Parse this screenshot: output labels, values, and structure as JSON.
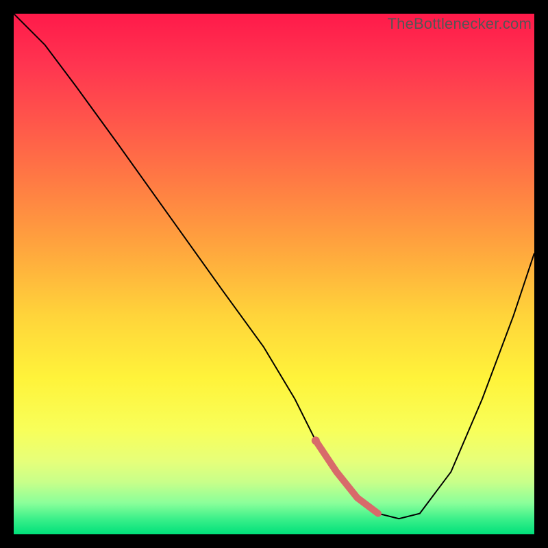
{
  "watermark": "TheBottlenecker.com",
  "chart_data": {
    "type": "line",
    "title": "",
    "xlabel": "",
    "ylabel": "",
    "xlim": [
      0,
      100
    ],
    "ylim": [
      0,
      100
    ],
    "series": [
      {
        "name": "curve",
        "x": [
          0,
          6,
          12,
          20,
          30,
          40,
          48,
          54,
          58,
          62,
          66,
          70,
          74,
          78,
          84,
          90,
          96,
          100
        ],
        "values": [
          100,
          94,
          86,
          75,
          61,
          47,
          36,
          26,
          18,
          12,
          7,
          4,
          3,
          4,
          12,
          26,
          42,
          54
        ]
      }
    ],
    "highlight_range_x": [
      56,
      72
    ],
    "gradient_stops": [
      {
        "pos": 0,
        "color": "#ff1a4a"
      },
      {
        "pos": 25,
        "color": "#ff7a44"
      },
      {
        "pos": 50,
        "color": "#ffd43a"
      },
      {
        "pos": 75,
        "color": "#f8ff5a"
      },
      {
        "pos": 100,
        "color": "#00e07a"
      }
    ]
  }
}
